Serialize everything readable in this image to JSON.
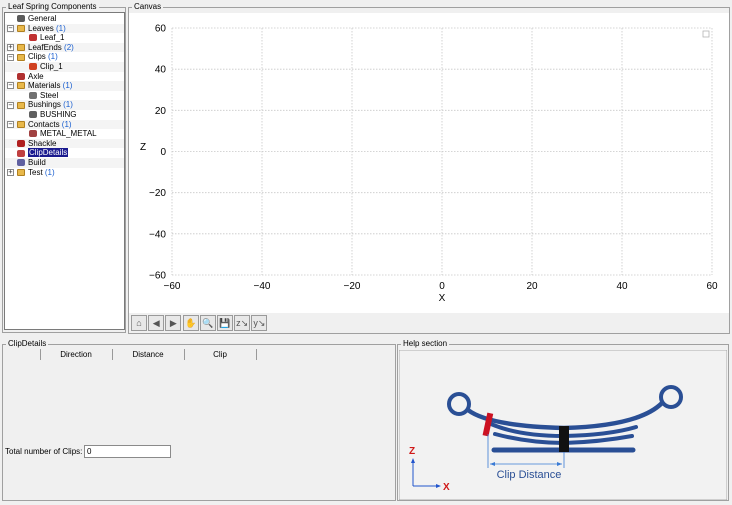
{
  "components_panel": {
    "title": "Leaf Spring Components",
    "tree": [
      {
        "label": "General",
        "count": "",
        "icon": "general-icon",
        "expander": "",
        "level": 1,
        "selected": false
      },
      {
        "label": "Leaves",
        "count": "(1)",
        "icon": "folder-icon",
        "expander": "−",
        "level": 0,
        "selected": false
      },
      {
        "label": "Leaf_1",
        "count": "",
        "icon": "leaf-icon",
        "expander": "",
        "level": 2,
        "selected": false
      },
      {
        "label": "LeafEnds",
        "count": "(2)",
        "icon": "folder-icon",
        "expander": "+",
        "level": 0,
        "selected": false
      },
      {
        "label": "Clips",
        "count": "(1)",
        "icon": "folder-icon",
        "expander": "−",
        "level": 0,
        "selected": false
      },
      {
        "label": "Clip_1",
        "count": "",
        "icon": "clip-icon",
        "expander": "",
        "level": 2,
        "selected": false
      },
      {
        "label": "Axle",
        "count": "",
        "icon": "axle-icon",
        "expander": "",
        "level": 1,
        "selected": false
      },
      {
        "label": "Materials",
        "count": "(1)",
        "icon": "folder-icon",
        "expander": "−",
        "level": 0,
        "selected": false
      },
      {
        "label": "Steel",
        "count": "",
        "icon": "material-icon",
        "expander": "",
        "level": 2,
        "selected": false
      },
      {
        "label": "Bushings",
        "count": "(1)",
        "icon": "folder-icon",
        "expander": "−",
        "level": 0,
        "selected": false
      },
      {
        "label": "BUSHING",
        "count": "",
        "icon": "bushing-icon",
        "expander": "",
        "level": 2,
        "selected": false
      },
      {
        "label": "Contacts",
        "count": "(1)",
        "icon": "folder-icon",
        "expander": "−",
        "level": 0,
        "selected": false
      },
      {
        "label": "METAL_METAL",
        "count": "",
        "icon": "contact-icon",
        "expander": "",
        "level": 2,
        "selected": false
      },
      {
        "label": "Shackle",
        "count": "",
        "icon": "shackle-icon",
        "expander": "",
        "level": 1,
        "selected": false
      },
      {
        "label": "ClipDetails",
        "count": "",
        "icon": "clipdetails-icon",
        "expander": "",
        "level": 1,
        "selected": true
      },
      {
        "label": "Build",
        "count": "",
        "icon": "build-icon",
        "expander": "",
        "level": 1,
        "selected": false
      },
      {
        "label": "Test",
        "count": "(1)",
        "icon": "folder-icon",
        "expander": "+",
        "level": 0,
        "selected": false
      }
    ]
  },
  "canvas": {
    "title": "Canvas",
    "xlabel": "X",
    "ylabel": "Z",
    "x_ticks": [
      "−60",
      "−40",
      "−20",
      "0",
      "20",
      "40",
      "60"
    ],
    "y_ticks": [
      "60",
      "40",
      "20",
      "0",
      "−20",
      "−40",
      "−60"
    ],
    "toolbar": [
      "home-icon",
      "back-arrow-icon",
      "forward-arrow-icon",
      "pan-hand-icon",
      "zoom-icon",
      "save-icon",
      "axes-xz-icon",
      "axes-xy-icon"
    ],
    "toolbar_glyphs": [
      "⌂",
      "◀",
      "▶",
      "✋",
      "🔍",
      "💾",
      "z↘",
      "y↘"
    ]
  },
  "chart_data": {
    "type": "scatter",
    "xlabel": "X",
    "ylabel": "Z",
    "xlim": [
      -60,
      60
    ],
    "ylim": [
      -60,
      60
    ],
    "grid": true,
    "series": []
  },
  "clip_details": {
    "title": "ClipDetails",
    "columns": [
      "Direction",
      "Distance",
      "Clip"
    ],
    "total_label": "Total number of Clips:",
    "total_value": "0"
  },
  "help": {
    "title": "Help section",
    "axis_z": "Z",
    "axis_x": "X",
    "caption": "Clip Distance",
    "colors": {
      "spring": "#2a4f95",
      "clip": "#cc1122",
      "dim": "#3a7bd5",
      "axis_red": "#d01818",
      "axis_blue": "#2255cc"
    }
  }
}
